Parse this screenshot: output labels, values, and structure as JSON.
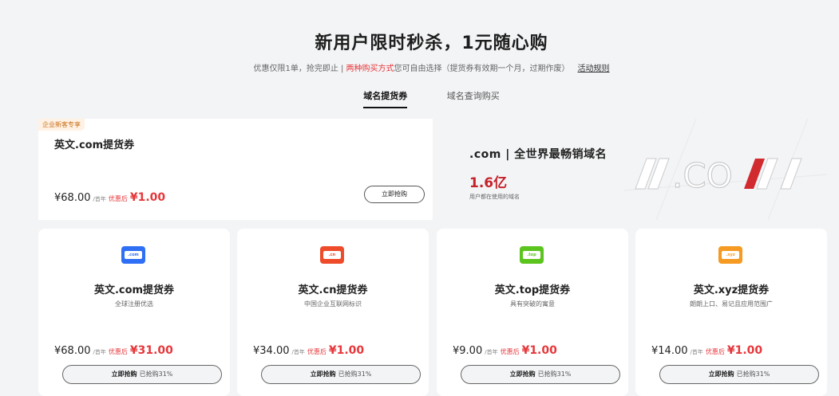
{
  "hero": {
    "title": "新用户限时秒杀，1元随心购",
    "sub_prefix": "优惠仅限1单，抢完即止 | ",
    "sub_red": "两种购买方式",
    "sub_suffix": "您可自由选择（提货券有效期一个月，过期作废）",
    "rule_link": "活动规则"
  },
  "tabs": [
    {
      "label": "域名提货券",
      "active": true
    },
    {
      "label": "域名查询购买",
      "active": false
    }
  ],
  "featured": {
    "tag": "企业新客专享",
    "title": "英文.com提货券",
    "price": "¥68.00",
    "unit": "/首年",
    "after_label": "优惠后",
    "after_price": "¥1.00",
    "button": "立即抢购"
  },
  "banner": {
    "title": ".com | 全世界最畅销域名",
    "number": "1.6亿",
    "caption": "用户都在使用的域名",
    "art_text": "/.COM/"
  },
  "cards": [
    {
      "icon": "com-ticket-icon",
      "icon_text": ".com",
      "color": "#2f6ff5",
      "title": "英文.com提货券",
      "desc": "全球注册优选",
      "price": "¥68.00",
      "unit": "/首年",
      "after_label": "优惠后",
      "after_price": "¥31.00",
      "btn_main": "立即抢购",
      "btn_sub": "已抢购31%"
    },
    {
      "icon": "cn-ticket-icon",
      "icon_text": ".cn",
      "color": "#ee4b2b",
      "title": "英文.cn提货券",
      "desc": "中国企业互联网标识",
      "price": "¥34.00",
      "unit": "/首年",
      "after_label": "优惠后",
      "after_price": "¥1.00",
      "btn_main": "立即抢购",
      "btn_sub": "已抢购31%"
    },
    {
      "icon": "top-ticket-icon",
      "icon_text": ".top",
      "color": "#5cc41e",
      "title": "英文.top提货券",
      "desc": "具有突破的寓意",
      "price": "¥9.00",
      "unit": "/首年",
      "after_label": "优惠后",
      "after_price": "¥1.00",
      "btn_main": "立即抢购",
      "btn_sub": "已抢购31%"
    },
    {
      "icon": "xyz-ticket-icon",
      "icon_text": ".xyz",
      "color": "#f59a23",
      "title": "英文.xyz提货券",
      "desc": "朗朗上口、易记且应用范围广",
      "price": "¥14.00",
      "unit": "/首年",
      "after_label": "优惠后",
      "after_price": "¥1.00",
      "btn_main": "立即抢购",
      "btn_sub": "已抢购31%"
    }
  ]
}
